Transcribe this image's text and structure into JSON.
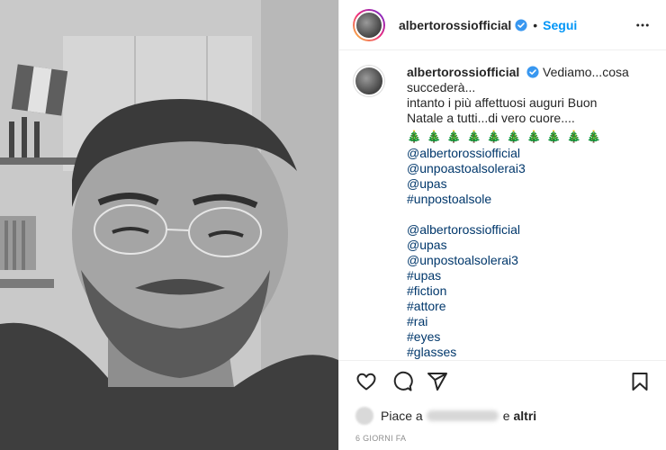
{
  "post": {
    "username": "albertorossiofficial",
    "verified": true,
    "follow_label": "Segui",
    "separator": "•"
  },
  "caption": {
    "username": "albertorossiofficial",
    "lines": [
      "Vediamo...cosa",
      "succederà...",
      "intanto i più affettuosi auguri Buon",
      "Natale a tutti...di vero cuore...."
    ],
    "trees": "🎄🎄🎄🎄🎄🎄🎄🎄🎄🎄",
    "tags_group1": [
      "@albertorossiofficial",
      "@unpoastoalsolerai3",
      "@upas",
      "#unpostoalsole"
    ],
    "tags_group2": [
      "@albertorossiofficial",
      "@upas",
      "@unpostoalsolerai3",
      "#upas",
      "#fiction",
      "#attore",
      "#rai",
      "#eyes",
      "#glasses"
    ]
  },
  "likes": {
    "prefix": "Piace a",
    "and": "e",
    "others": "altri"
  },
  "timestamp": "6 GIORNI FA",
  "colors": {
    "accent": "#0095f6",
    "tag": "#00376b",
    "muted": "#8e8e8e",
    "border": "#efefef"
  },
  "icons": [
    "verified-icon",
    "more-options-icon",
    "heart-icon",
    "comment-icon",
    "share-icon",
    "bookmark-icon"
  ]
}
